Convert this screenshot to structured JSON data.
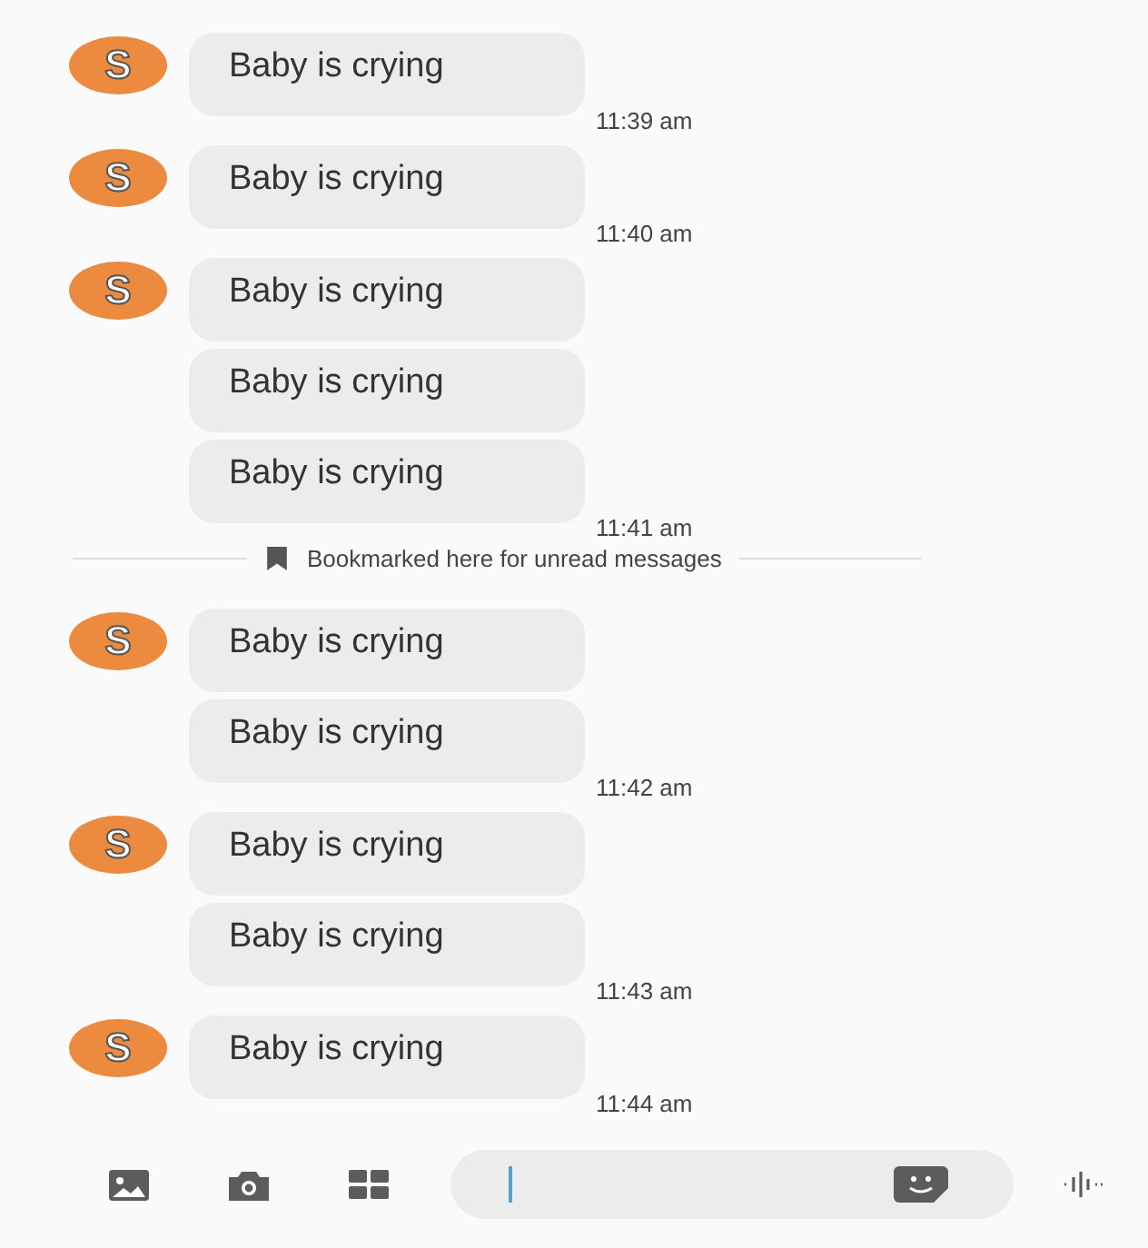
{
  "conversation": [
    {
      "kind": "group",
      "avatar": "S",
      "messages": [
        "Baby is crying"
      ],
      "time": "11:39 am"
    },
    {
      "kind": "group",
      "avatar": "S",
      "messages": [
        "Baby is crying"
      ],
      "time": "11:40 am"
    },
    {
      "kind": "group",
      "avatar": "S",
      "messages": [
        "Baby is crying",
        "Baby is crying",
        "Baby is crying"
      ],
      "time": "11:41 am"
    },
    {
      "kind": "divider",
      "text": "Bookmarked here for unread messages"
    },
    {
      "kind": "group",
      "avatar": "S",
      "messages": [
        "Baby is crying",
        "Baby is crying"
      ],
      "time": "11:42 am"
    },
    {
      "kind": "group",
      "avatar": "S",
      "messages": [
        "Baby is crying",
        "Baby is crying"
      ],
      "time": "11:43 am"
    },
    {
      "kind": "group",
      "avatar": "S",
      "messages": [
        "Baby is crying"
      ],
      "time": "11:44 am"
    }
  ]
}
